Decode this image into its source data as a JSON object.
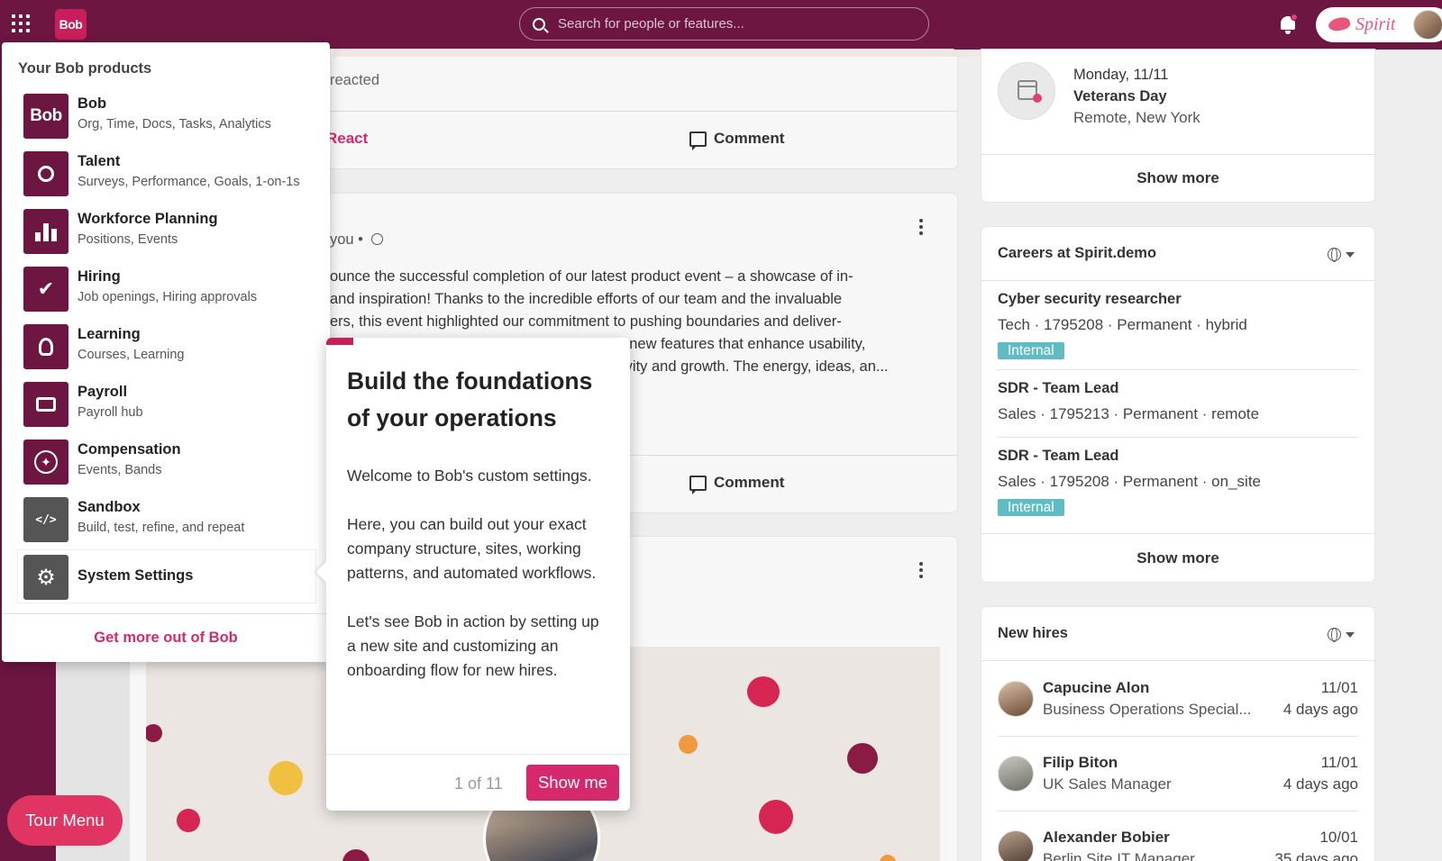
{
  "topbar": {
    "logo_text": "Bob",
    "search_placeholder": "Search for people or features...",
    "company_name": "Spirit"
  },
  "feed": {
    "post1_reacted": "reacted",
    "react_label": "React",
    "comment_label": "Comment",
    "post2_meta": "you •",
    "post2_lines": [
      "ounce the successful completion of our latest product event – a showcase of in-",
      "and inspiration! Thanks to the incredible efforts of our team and the invaluable",
      "ers, this event highlighted our commitment to pushing boundaries and deliver-",
      "l new features that enhance usability,",
      "ivity and growth. The energy, ideas, an..."
    ]
  },
  "holiday": {
    "date": "Monday, 11/11",
    "name": "Veterans Day",
    "location": "Remote, New York",
    "show_more": "Show more"
  },
  "careers": {
    "title": "Careers at Spirit.demo",
    "jobs": [
      {
        "title": "Cyber security researcher",
        "meta": "Tech · 1795208 · Permanent · hybrid",
        "badge": "Internal"
      },
      {
        "title": "SDR - Team Lead",
        "meta": "Sales · 1795213 · Permanent · remote",
        "badge": ""
      },
      {
        "title": "SDR - Team Lead",
        "meta": "Sales · 1795208 · Permanent · on_site",
        "badge": "Internal"
      }
    ],
    "show_more": "Show more"
  },
  "new_hires": {
    "title": "New hires",
    "people": [
      {
        "name": "Capucine Alon",
        "role": "Business Operations Special...",
        "date": "11/01",
        "ago": "4 days ago"
      },
      {
        "name": "Filip Biton",
        "role": "UK Sales Manager",
        "date": "11/01",
        "ago": "4 days ago"
      },
      {
        "name": "Alexander Bobier",
        "role": "Berlin Site IT Manager",
        "date": "10/01",
        "ago": "35 days ago"
      }
    ]
  },
  "products": {
    "heading": "Your Bob products",
    "items": [
      {
        "name": "Bob",
        "desc": "Org, Time, Docs, Tasks, Analytics",
        "icon": "bob-logo-icon"
      },
      {
        "name": "Talent",
        "desc": "Surveys, Performance, Goals, 1-on-1s",
        "icon": "award-icon"
      },
      {
        "name": "Workforce Planning",
        "desc": "Positions, Events",
        "icon": "bar-chart-people-icon"
      },
      {
        "name": "Hiring",
        "desc": "Job openings, Hiring approvals",
        "icon": "person-check-icon"
      },
      {
        "name": "Learning",
        "desc": "Courses, Learning",
        "icon": "lightbulb-icon"
      },
      {
        "name": "Payroll",
        "desc": "Payroll hub",
        "icon": "wallet-icon"
      },
      {
        "name": "Compensation",
        "desc": "Events, Bands",
        "icon": "compass-icon"
      },
      {
        "name": "Sandbox",
        "desc": "Build, test, refine, and repeat",
        "icon": "code-hexagon-icon"
      },
      {
        "name": "System Settings",
        "desc": "",
        "icon": "gears-icon"
      }
    ],
    "footer_link": "Get more out of Bob"
  },
  "tour": {
    "title": "Build the foundations of your operations",
    "paragraphs": [
      "Welcome to Bob's custom settings.",
      "Here, you can build out your exact company structure, sites, working patterns, and automated workflows.",
      "Let's see Bob in action by setting up a new site and customizing an onboarding flow for new hires."
    ],
    "step": "1 of 11",
    "button": "Show me"
  },
  "tour_menu_label": "Tour Menu",
  "colors": {
    "brand": "#6d1642",
    "accent": "#d6286c",
    "badge": "#5fbcc4"
  }
}
